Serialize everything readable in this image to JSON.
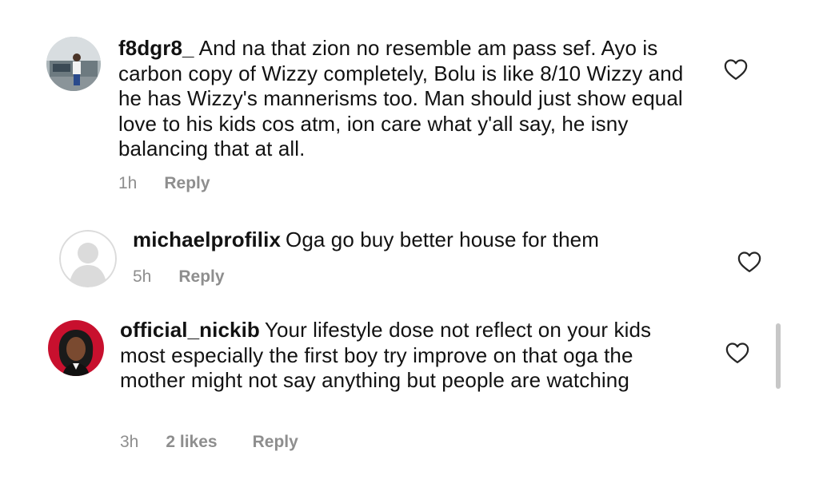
{
  "comments": [
    {
      "username": "f8dgr8_",
      "text": "And na that zion no resemble am pass sef. Ayo is carbon copy of Wizzy completely, Bolu is like 8/10 Wizzy and he has Wizzy's mannerisms too. Man should just show equal love to his kids cos atm, ion care what y'all say, he isny balancing that at all.",
      "time": "1h",
      "reply_label": "Reply"
    },
    {
      "username": "michaelprofilix",
      "text": "Oga go buy better house for them",
      "time": "5h",
      "reply_label": "Reply"
    },
    {
      "username": "official_nickib",
      "text": "Your lifestyle dose not reflect on your kids most especially the first boy try improve on that oga the mother might not say anything but people are watching",
      "time": "3h",
      "likes": "2 likes",
      "reply_label": "Reply"
    }
  ],
  "colors": {
    "text": "#121212",
    "meta": "#8e8e8e",
    "heart_stroke": "#262626",
    "scrollbar": "#c7c7c7"
  },
  "icons": [
    "heart-outline-icon",
    "default-avatar-icon"
  ]
}
